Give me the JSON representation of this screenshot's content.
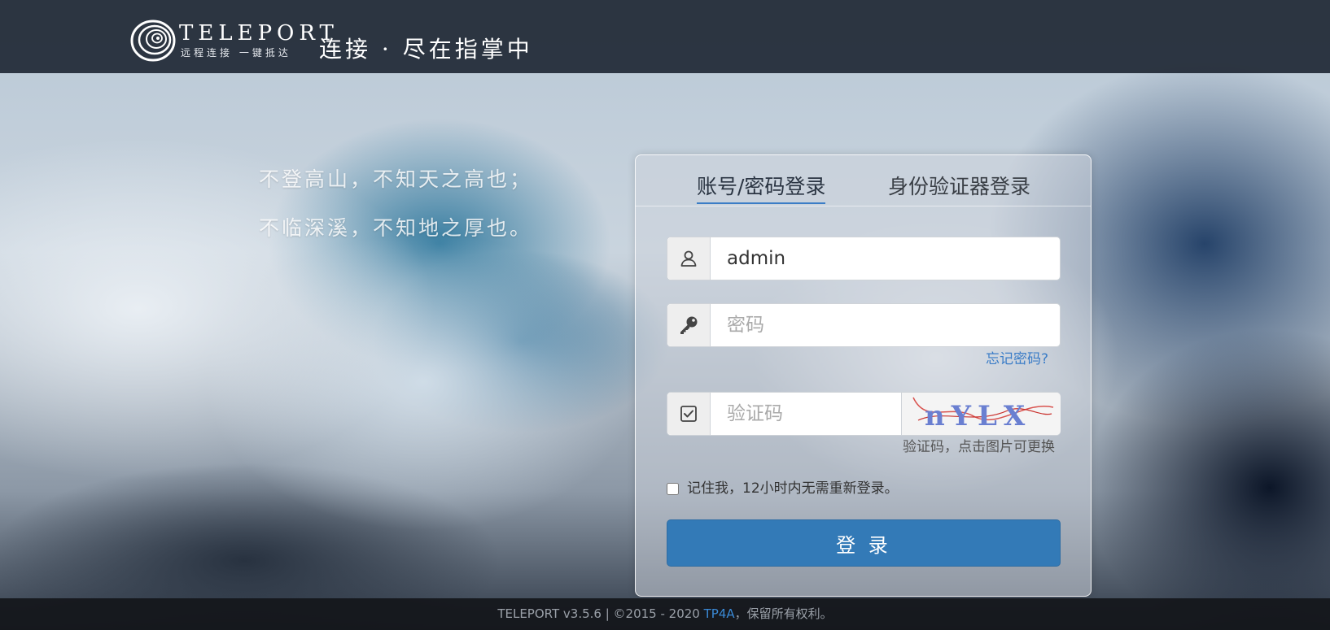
{
  "header": {
    "brand_name": "TELEPORT",
    "brand_subtitle": "远程连接 一键抵达",
    "slogan": "连接 · 尽在指掌中"
  },
  "poem": {
    "line1": "不登高山，不知天之高也；",
    "line2": "不临深溪，不知地之厚也。"
  },
  "login": {
    "tabs": [
      {
        "label": "账号/密码登录",
        "active": true
      },
      {
        "label": "身份验证器登录",
        "active": false
      }
    ],
    "username": {
      "value": "admin",
      "icon": "user-icon"
    },
    "password": {
      "value": "",
      "placeholder": "密码",
      "icon": "key-icon"
    },
    "forgot_password": "忘记密码?",
    "captcha": {
      "value": "",
      "placeholder": "验证码",
      "icon": "check-square-icon",
      "image_text": "nYLX",
      "hint": "验证码，点击图片可更换"
    },
    "remember_me": {
      "checked": false,
      "label": "记住我，12小时内无需重新登录。"
    },
    "submit_label": "登 录"
  },
  "footer": {
    "prefix": "TELEPORT v3.5.6 | ©2015 - 2020 ",
    "link": "TP4A",
    "suffix": "，保留所有权利。"
  },
  "colors": {
    "accent": "#337ab7",
    "link": "#3a7cc7",
    "header_bg": "#18202c"
  }
}
